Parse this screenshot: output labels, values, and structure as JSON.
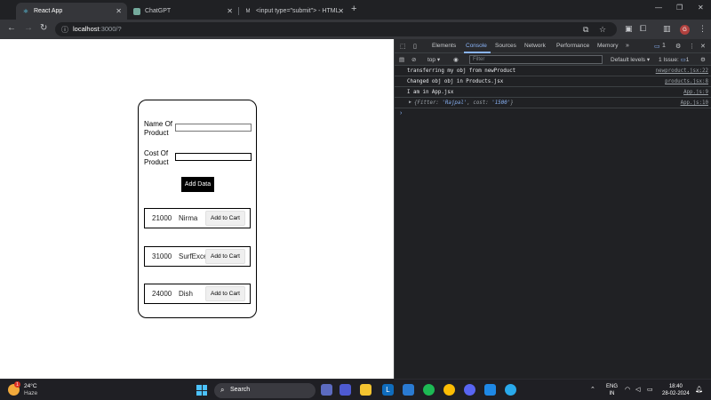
{
  "browser": {
    "tabs": [
      {
        "title": "React App",
        "active": true
      },
      {
        "title": "ChatGPT",
        "active": false
      },
      {
        "title": "<input type=\"submit\"> - HTML",
        "active": false
      }
    ],
    "url_host": "localhost",
    "url_rest": ":3000/?"
  },
  "form": {
    "name_label": "Name Of Product",
    "name_value": "",
    "cost_label": "Cost Of Product",
    "cost_value": "",
    "add_button": "Add Data"
  },
  "products": [
    {
      "cost": "21000",
      "name": "Nirma",
      "button": "Add to Cart"
    },
    {
      "cost": "31000",
      "name": "SurfExcel",
      "button": "Add to Cart"
    },
    {
      "cost": "24000",
      "name": "Dish",
      "button": "Add to Cart"
    }
  ],
  "devtools": {
    "tabs": [
      "Elements",
      "Console",
      "Sources",
      "Network",
      "Performance",
      "Memory"
    ],
    "active_tab": "Console",
    "context": "top",
    "filter_placeholder": "Filter",
    "levels": "Default levels",
    "issues": "1 Issue:",
    "issues_count": "1",
    "messages_badge": "1",
    "logs": [
      {
        "message": "transferring my obj from newProduct",
        "source": "newproduct.jsx:22"
      },
      {
        "message": "Changed obj obj in Products.jsx",
        "source": "products.jsx:8"
      },
      {
        "message": "I am in App.jsx",
        "source": "App.js:9"
      },
      {
        "message_prefix": "{Fitter: ",
        "message_name": "'Rajpal'",
        "message_mid": ", cost: ",
        "message_cost": "'1500'",
        "message_suffix": "}",
        "source": "App.js:10"
      }
    ]
  },
  "taskbar": {
    "temperature": "24°C",
    "weather": "Haze",
    "weather_badge": "1",
    "search": "Search",
    "lang_line1": "ENG",
    "lang_line2": "IN",
    "time": "18:40",
    "date": "28-02-2024"
  },
  "colors": {
    "accent": "#8ab4f8",
    "chrome_dark": "#202124",
    "chrome_tab": "#35363a"
  }
}
